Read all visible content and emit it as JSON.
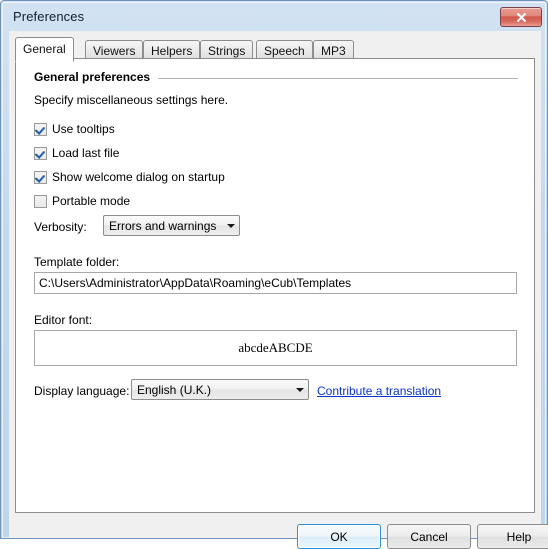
{
  "window": {
    "title": "Preferences",
    "close_icon": "close-x-icon"
  },
  "tabs": [
    {
      "label": "General",
      "selected": true
    },
    {
      "label": "Viewers",
      "selected": false
    },
    {
      "label": "Helpers",
      "selected": false
    },
    {
      "label": "Strings",
      "selected": false
    },
    {
      "label": "Speech",
      "selected": false
    },
    {
      "label": "MP3",
      "selected": false
    }
  ],
  "general": {
    "group_title": "General preferences",
    "description": "Specify miscellaneous settings here.",
    "checkboxes": [
      {
        "label": "Use tooltips",
        "checked": true
      },
      {
        "label": "Load last file",
        "checked": true
      },
      {
        "label": "Show welcome dialog on startup",
        "checked": true
      },
      {
        "label": "Portable mode",
        "checked": false
      }
    ],
    "verbosity": {
      "label": "Verbosity:",
      "value": "Errors and warnings",
      "options": [
        "Errors and warnings"
      ]
    },
    "template_folder": {
      "label": "Template folder:",
      "value": "C:\\Users\\Administrator\\AppData\\Roaming\\eCub\\Templates"
    },
    "editor_font": {
      "label": "Editor font:",
      "sample": "abcdeABCDE"
    },
    "display_language": {
      "label": "Display language:",
      "value": "English (U.K.)",
      "options": [
        "English (U.K.)"
      ],
      "link": "Contribute a translation"
    }
  },
  "buttons": {
    "ok": "OK",
    "cancel": "Cancel",
    "help": "Help"
  },
  "colors": {
    "link": "#0b34d0",
    "accent": "#2f8fd8",
    "close": "#d0574a"
  }
}
